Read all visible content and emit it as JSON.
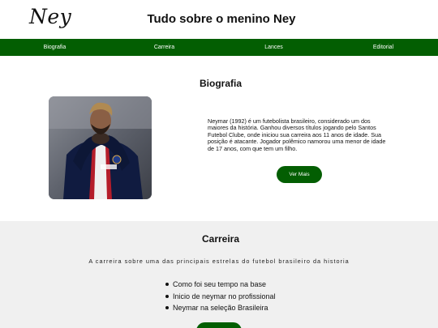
{
  "header": {
    "logo": "Ney",
    "title": "Tudo sobre o menino Ney"
  },
  "nav": {
    "items": [
      "Biografia",
      "Carreira",
      "Lances",
      "Editorial"
    ]
  },
  "bio": {
    "heading": "Biografia",
    "photo_alt": "Neymar com camisa do PSG",
    "text": "Neymar (1992) é um futebolista brasileiro, considerado um dos maiores da história. Ganhou diversos títulos jogando pelo Santos Futebol Clube, onde iniciou sua carreira aos 11 anos de idade. Sua posição é atacante. Jogador polêmico namorou uma menor de idade de 17 anos, com que tem um filho.",
    "button": "Ver Mais"
  },
  "career": {
    "heading": "Carreira",
    "subtitle": "A carreira sobre uma das principais estrelas do futebol brasileiro da historia",
    "items": [
      "Como foi seu tempo na base",
      "Inicio de neymar no profissional",
      "Neymar na seleção Brasileira"
    ]
  },
  "colors": {
    "nav_green": "#035e02",
    "career_bg": "#f0f0f0"
  }
}
